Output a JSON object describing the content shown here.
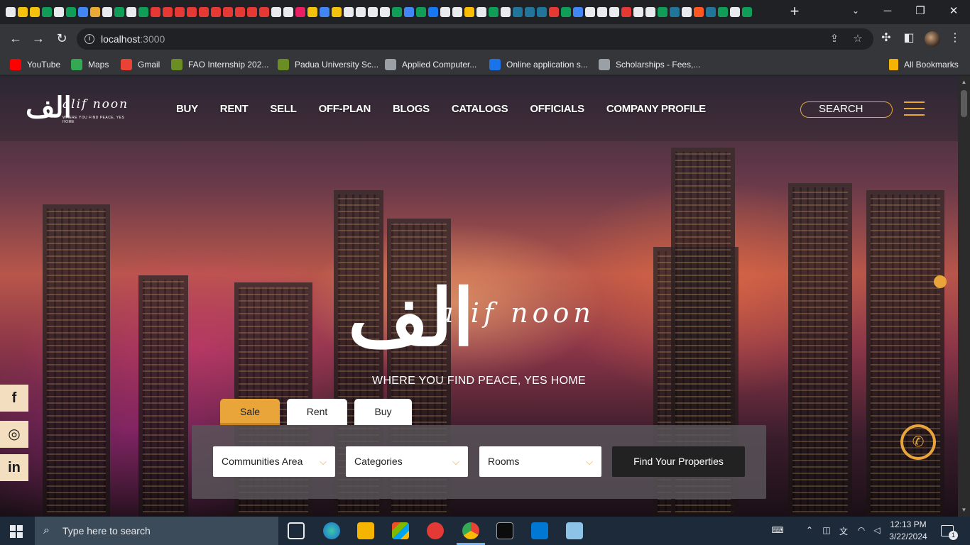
{
  "browser": {
    "tab_favicon_colors": [
      "#e8eaed",
      "#f4c20d",
      "#f4c20d",
      "#0f9d58",
      "#e8eaed",
      "#0f9d58",
      "#4285f4",
      "#e8a935",
      "#e8eaed",
      "#0f9d58",
      "#e8eaed",
      "#0f9d58",
      "#e53935",
      "#e53935",
      "#e53935",
      "#e53935",
      "#e53935",
      "#e53935",
      "#e53935",
      "#e53935",
      "#e53935",
      "#e53935",
      "#e8eaed",
      "#e8eaed",
      "#e91e63",
      "#f4c20d",
      "#4285f4",
      "#f4c20d",
      "#e8eaed",
      "#e8eaed",
      "#e8eaed",
      "#e8eaed",
      "#0f9d58",
      "#4285f4",
      "#0f9d58",
      "#1877f2",
      "#e8eaed",
      "#e8eaed",
      "#fbbc04",
      "#e8eaed",
      "#0f9d58",
      "#e8eaed",
      "#21759b",
      "#21759b",
      "#21759b",
      "#e53935",
      "#0f9d58",
      "#4285f4",
      "#e8eaed",
      "#e8eaed",
      "#e8eaed",
      "#e53935",
      "#e8eaed",
      "#e8eaed",
      "#0f9d58",
      "#21759b",
      "#e8eaed",
      "#ff5722",
      "#21759b",
      "#0f9d58",
      "#e8eaed",
      "#0f9d58"
    ],
    "new_tab_label": "+",
    "url_host": "localhost",
    "url_port": ":3000",
    "bookmarks": [
      {
        "label": "YouTube",
        "color": "#ff0000"
      },
      {
        "label": "Maps",
        "color": "#34a853"
      },
      {
        "label": "Gmail",
        "color": "#ea4335"
      },
      {
        "label": "FAO Internship 202...",
        "color": "#6b8e23"
      },
      {
        "label": "Padua University Sc...",
        "color": "#6b8e23"
      },
      {
        "label": "Applied Computer...",
        "color": "#9aa0a6"
      },
      {
        "label": "Online application s...",
        "color": "#1a73e8"
      },
      {
        "label": "Scholarships - Fees,...",
        "color": "#9aa0a6"
      }
    ],
    "all_bookmarks_label": "All Bookmarks"
  },
  "site": {
    "logo_glyph": "الف",
    "logo_script": "alif noon",
    "logo_tagline": "WHERE YOU FIND PEACE, YES HOME",
    "menu": [
      "BUY",
      "RENT",
      "SELL",
      "OFF-PLAN",
      "BLOGS",
      "CATALOGS",
      "OFFICIALS",
      "COMPANY PROFILE"
    ],
    "search_label": "SEARCH",
    "hero_tagline": "WHERE YOU FIND PEACE, YES HOME",
    "hero_tabs": [
      "Sale",
      "Rent",
      "Buy"
    ],
    "active_tab": "Sale",
    "dropdowns": [
      "Communities Area",
      "Categories",
      "Rooms"
    ],
    "find_button": "Find Your Properties",
    "social": [
      "f",
      "◎",
      "in"
    ],
    "accent_color": "#e9a53a"
  },
  "taskbar": {
    "search_placeholder": "Type here to search",
    "time": "12:13 PM",
    "date": "3/22/2024",
    "notification_count": "1"
  }
}
